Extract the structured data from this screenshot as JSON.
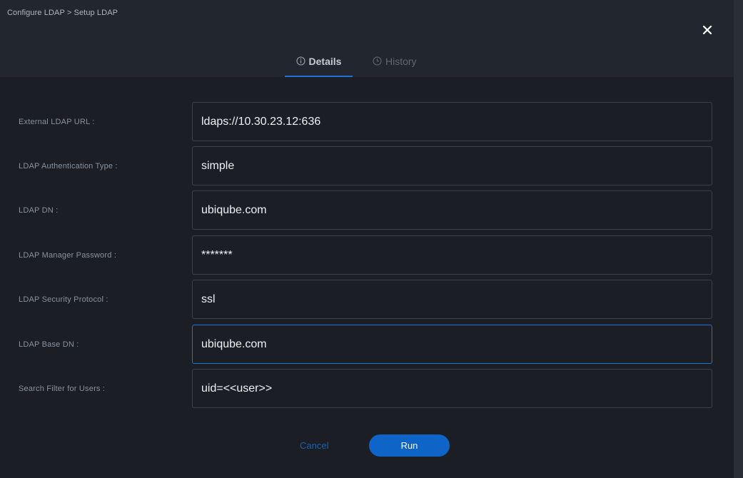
{
  "breadcrumb": "Configure LDAP > Setup LDAP",
  "tabs": {
    "details": {
      "label": "Details",
      "icon": "info-circle-icon"
    },
    "history": {
      "label": "History",
      "icon": "clock-icon"
    }
  },
  "fields": [
    {
      "label": "External LDAP URL :",
      "value": "ldaps://10.30.23.12:636"
    },
    {
      "label": "LDAP Authentication Type :",
      "value": "simple"
    },
    {
      "label": "LDAP DN :",
      "value": "ubiqube.com"
    },
    {
      "label": "LDAP Manager Password :",
      "value": "*******"
    },
    {
      "label": "LDAP Security Protocol :",
      "value": "ssl"
    },
    {
      "label": "LDAP Base DN :",
      "value": "ubiqube.com"
    },
    {
      "label": "Search Filter for Users :",
      "value": "uid=<<user>>"
    }
  ],
  "actions": {
    "cancel_label": "Cancel",
    "run_label": "Run"
  },
  "colors": {
    "accent": "#1e73d6",
    "primary_button": "#0f64c8",
    "background": "#1b1f25",
    "header": "#22272f"
  }
}
